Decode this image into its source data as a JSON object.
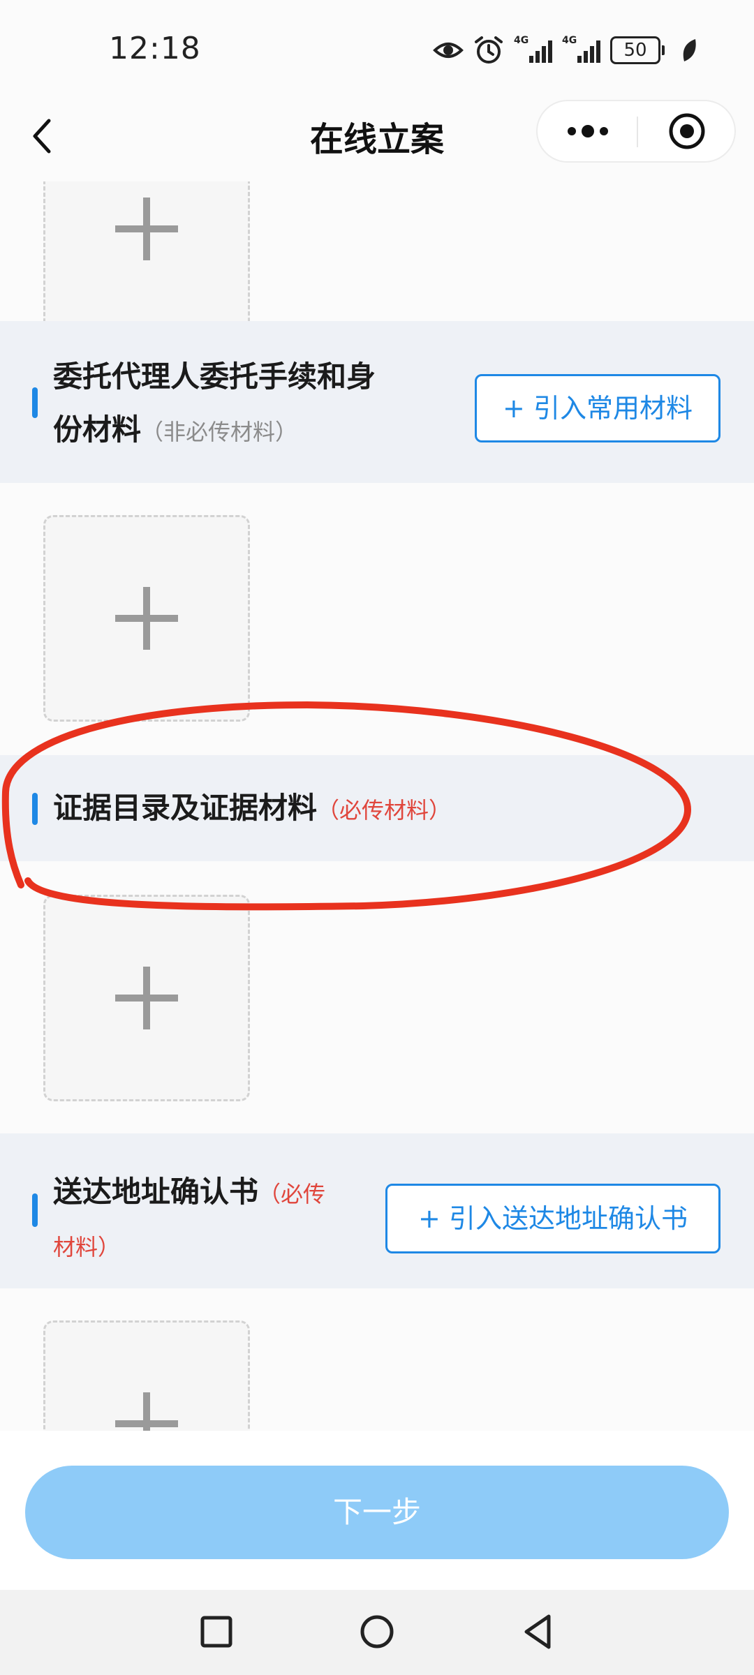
{
  "status_bar": {
    "time": "12:18",
    "network_1": "4G",
    "network_2": "4G",
    "battery": "50",
    "icons": [
      "eye-icon",
      "alarm-icon",
      "signal-icon",
      "signal-icon",
      "battery-icon",
      "leaf-icon"
    ]
  },
  "nav": {
    "title": "在线立案",
    "icons": [
      "back-icon",
      "more-icon",
      "target-icon"
    ]
  },
  "sections": [
    {
      "title_line1": "委托代理人委托手续和身",
      "title_line2": "份材料",
      "note": "（非必传材料）",
      "button": "+ 引入常用材料"
    },
    {
      "title": "证据目录及证据材料",
      "note": "（必传材料）"
    },
    {
      "title": "送达地址确认书",
      "note_line1": "（必传",
      "note_line2": "材料）",
      "button": "+ 引入送达地址确认书"
    }
  ],
  "footer": {
    "next_button": "下一步"
  },
  "colors": {
    "accent": "#1e88e5",
    "required_note": "#e0463c",
    "optional_note": "#8b8b8b",
    "section_bg": "#eef1f6",
    "next_button_bg": "#8ecbf8",
    "annotation_stroke": "#e8321e"
  }
}
